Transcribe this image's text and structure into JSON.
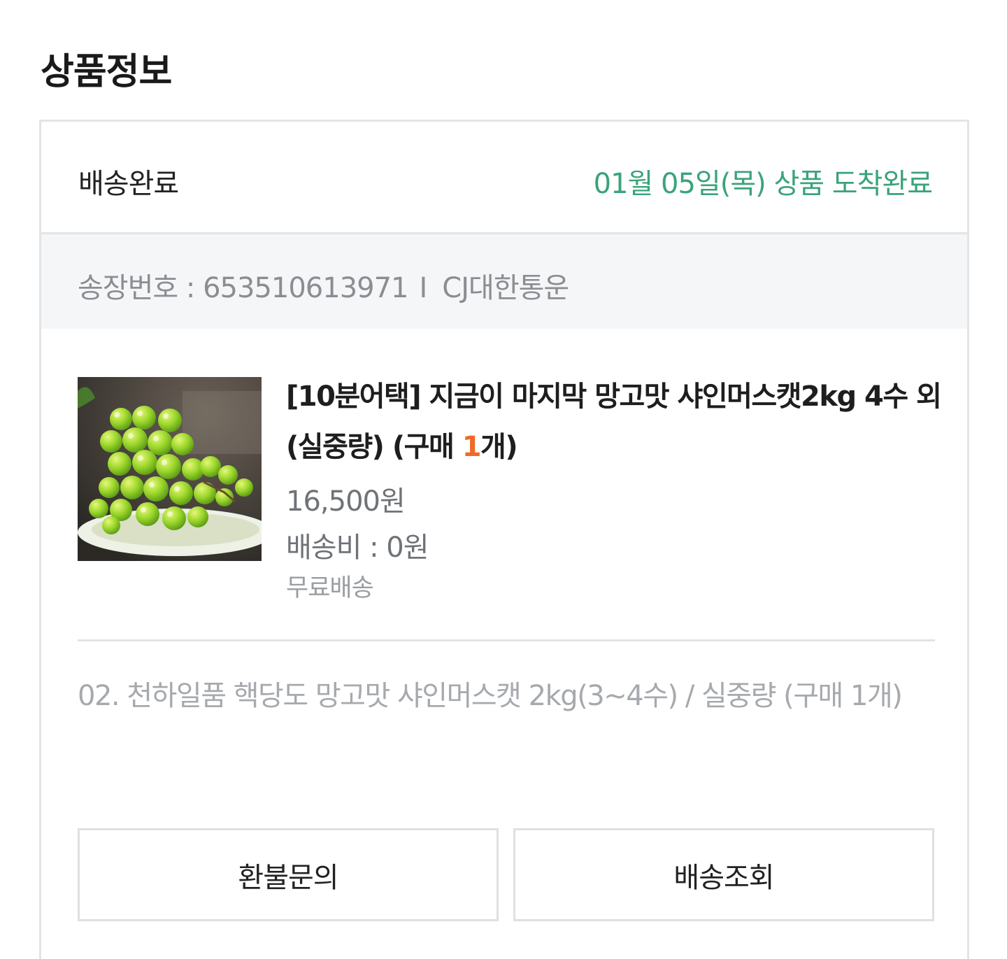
{
  "page": {
    "title": "상품정보"
  },
  "status": {
    "label": "배송완료",
    "arrival_text": "01월 05일(목) 상품 도착완료",
    "arrival_color": "#3aa37a"
  },
  "tracking": {
    "label": "송장번호 : 653510613971",
    "separator": "I",
    "carrier": "CJ대한통운"
  },
  "product": {
    "name_main": "[10분어택] 지금이 마지막 망고맛 샤인머스캣2kg 4수 외 (실중량) (구매 ",
    "quantity": "1",
    "quantity_suffix": "개)",
    "quantity_color": "#ee6a28",
    "price": "16,500원",
    "shipping_fee": "배송비 : 0원",
    "shipping_type": "무료배송",
    "image_icon": "green-grapes-image"
  },
  "second_item": {
    "text": "02. 천하일품 핵당도 망고맛 샤인머스캣 2kg(3~4수) / 실중량 (구매 1개)"
  },
  "buttons": {
    "refund": "환불문의",
    "track": "배송조회"
  }
}
